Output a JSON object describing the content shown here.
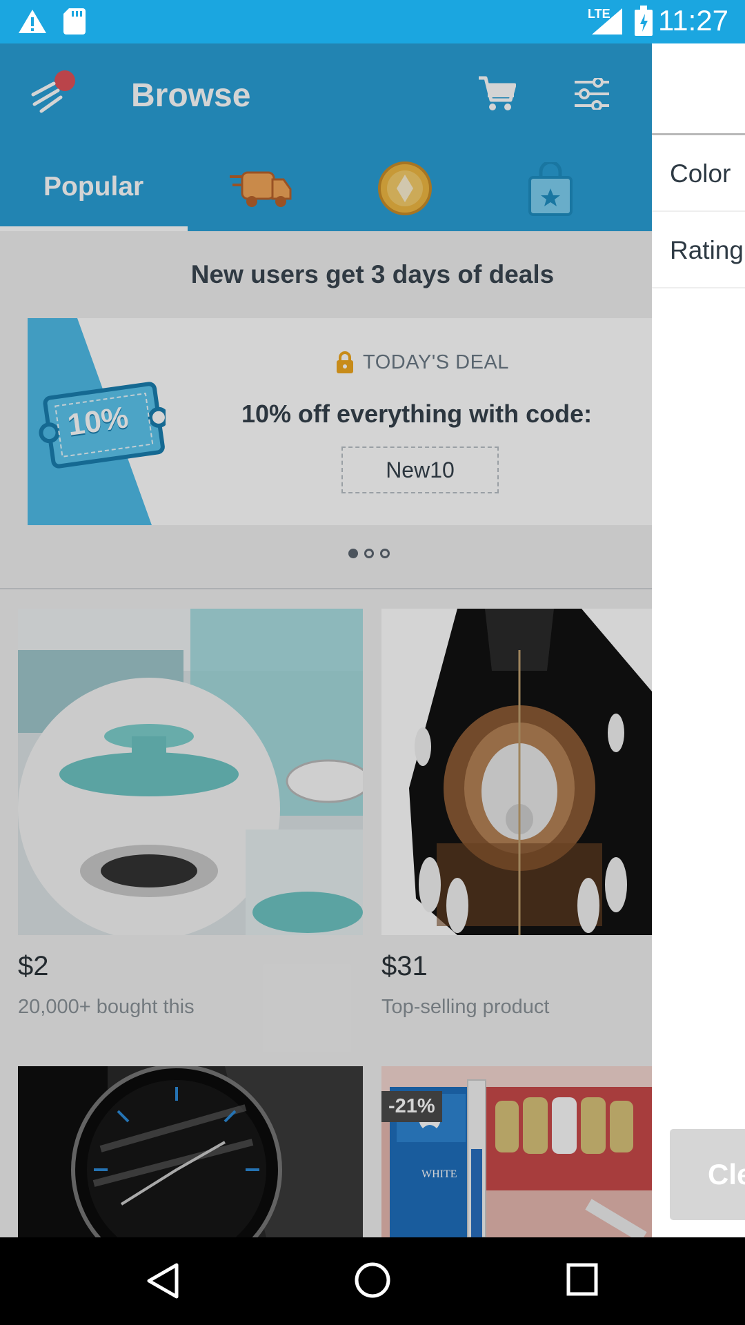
{
  "status_bar": {
    "time": "11:27",
    "network": "LTE"
  },
  "app_bar": {
    "title": "Browse"
  },
  "tabs": [
    {
      "label": "Popular"
    }
  ],
  "banner": {
    "header": "New users get 3 days of deals",
    "badge_text": "10%",
    "deal_label": "TODAY'S DEAL",
    "deal_text": "10% off everything with code:",
    "code": "New10"
  },
  "products": [
    {
      "price": "$2",
      "subtitle": "20,000+ bought this"
    },
    {
      "price": "$31",
      "subtitle": "Top-selling product"
    },
    {
      "discount": null
    },
    {
      "discount": "-21%"
    }
  ],
  "drawer": {
    "items": [
      {
        "label": "Color"
      },
      {
        "label": "Rating"
      }
    ],
    "clear_label": "Clear"
  },
  "colors": {
    "primary": "#2a9fd6",
    "status_bar": "#1ba6e0"
  }
}
